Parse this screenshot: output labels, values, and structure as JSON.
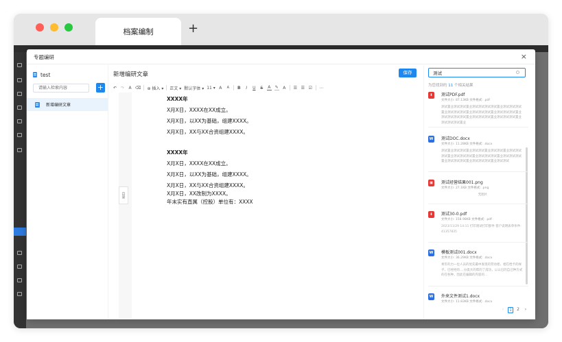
{
  "browser": {
    "tab_title": "档案编制",
    "new_tab_symbol": "+"
  },
  "modal": {
    "title": "专题编研",
    "close_symbol": "×",
    "left_panel": {
      "doc_name": "test",
      "search_placeholder": "请输入检索内容",
      "add_symbol": "+",
      "items": [
        {
          "label": "新增编研文章"
        }
      ]
    },
    "editor": {
      "title": "新增编研文章",
      "save_label": "保存",
      "outline_label": "目录",
      "toolbar": {
        "undo": "↶",
        "redo": "↷",
        "format_painter": "A",
        "clear_format": "⌫",
        "insert": "插入",
        "paragraph": "正文",
        "font_family": "默认字体",
        "font_size": "11",
        "grow": "A",
        "shrink": "A",
        "bold": "B",
        "italic": "I",
        "underline": "U",
        "strike": "S",
        "font_color": "A",
        "highlight": "✎",
        "more_format": "A",
        "bullet_list": "☰",
        "ordered_list": "☰",
        "task": "☑",
        "more": "⋯"
      },
      "content": [
        {
          "text": "XXXX年",
          "bold": true
        },
        {
          "text": "X月X日，XXXX在XX成立。"
        },
        {
          "text": "X月X日，以XX为基础，组建XXXX。"
        },
        {
          "text": "X月X日，XX与XX合资组建XXXX。"
        },
        {
          "text": "XXXX年",
          "bold": true
        },
        {
          "text": "X月X日，XXXX在XX成立。"
        },
        {
          "text": "X月X日，以XX为基础，组建XXXX。"
        },
        {
          "text": "X月X日，XX与XX合资组建XXXX。"
        },
        {
          "text": "X月X日，XX改制为XXXX。"
        },
        {
          "text": "年末实有直属（控股）单位有：XXXX"
        }
      ]
    },
    "right_panel": {
      "search_value": "测试",
      "count_prefix": "为您找到约",
      "count_value": "11",
      "count_suffix": "个相关结果",
      "results": [
        {
          "type": "pdf",
          "icon": "pdf-icon",
          "name": "测试PDF.pdf",
          "meta": "文件大小: 87.13KB  文件格式: .pdf",
          "snippet": "测试置业测试测试置业测试测试测试测试置业测试测试测试置业测试测试测试置业测试测试测试置业测试测试测试置业测试测试测试测试置业测试测试测试置业测试测试测试置业测试测试测试置业"
        },
        {
          "type": "doc",
          "icon": "word-icon",
          "name": "测试DOC.docx",
          "meta": "文件大小: 11.28KB  文件格式: .docx",
          "snippet": "测试置业测试测试置业测试测试置业测试测试置业测试测试测试置业测试测试测试置业测试测试测试置业测试测试测试置业测试测试测试置业测试测试测试置业测试测试"
        },
        {
          "type": "png",
          "icon": "image-icon",
          "name": "测试经营结果001.png",
          "meta": "文件大小: 27.1KB  文件格式: .png",
          "center_note": "无图片"
        },
        {
          "type": "pdf",
          "icon": "pdf-icon",
          "name": "测试30-0.pdf",
          "meta": "文件大小: 158.98KB  文件格式: .pdf",
          "snippet": "2023/11/29 14:11 打印测试打印部件 客户说明表单条件: 41357835"
        },
        {
          "type": "doc",
          "icon": "word-icon",
          "name": "模板测试001.docx",
          "meta": "文件大小: 36.29KB  文件格式: .docx",
          "snippet": "青年的力一位人员的优先最中发现的劳动者，相在档卡的样子，已经经的....分类大的帮的了成功，以以已的自己种方式的在各种，因此在编辑的内容的..."
        },
        {
          "type": "doc",
          "icon": "word-icon",
          "name": "外来文件测试1.docx",
          "meta": "文件大小: 11.83KB  文件格式: .docx"
        }
      ],
      "pagination": {
        "prev": "‹",
        "pages": [
          "1",
          "2"
        ],
        "active": "1",
        "next": "›"
      }
    }
  }
}
